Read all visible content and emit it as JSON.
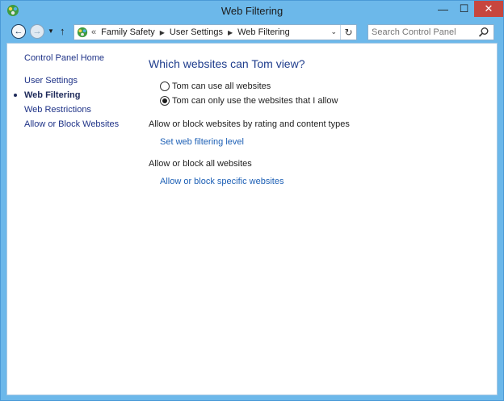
{
  "window": {
    "title": "Web Filtering",
    "minimize_label": "—",
    "maximize_label": "☐",
    "close_label": "✕"
  },
  "navigation": {
    "back_icon": "back-arrow-icon",
    "forward_icon": "forward-arrow-icon",
    "recent_icon": "chevron-down-icon",
    "up_icon": "up-arrow-icon"
  },
  "address_bar": {
    "overflow": "«",
    "breadcrumbs": [
      "Family Safety",
      "User Settings",
      "Web Filtering"
    ]
  },
  "search": {
    "placeholder": "Search Control Panel"
  },
  "sidebar": {
    "home": "Control Panel Home",
    "items": [
      {
        "label": "User Settings"
      },
      {
        "label": "Web Filtering",
        "current": true
      },
      {
        "label": "Web Restrictions"
      },
      {
        "label": "Allow or Block Websites"
      }
    ]
  },
  "main": {
    "heading": "Which websites can Tom view?",
    "options": [
      {
        "label": "Tom can use all websites",
        "selected": false
      },
      {
        "label": "Tom can only use the websites that I allow",
        "selected": true
      }
    ],
    "sections": [
      {
        "label": "Allow or block websites by rating and content types",
        "link": "Set web filtering level"
      },
      {
        "label": "Allow or block all websites",
        "link": "Allow or block specific websites"
      }
    ]
  },
  "colors": {
    "frame": "#6cb8ea",
    "close_button": "#c7463e",
    "heading": "#1e3c8c",
    "link": "#1c5fb5",
    "sidebar_link": "#1e3287"
  }
}
